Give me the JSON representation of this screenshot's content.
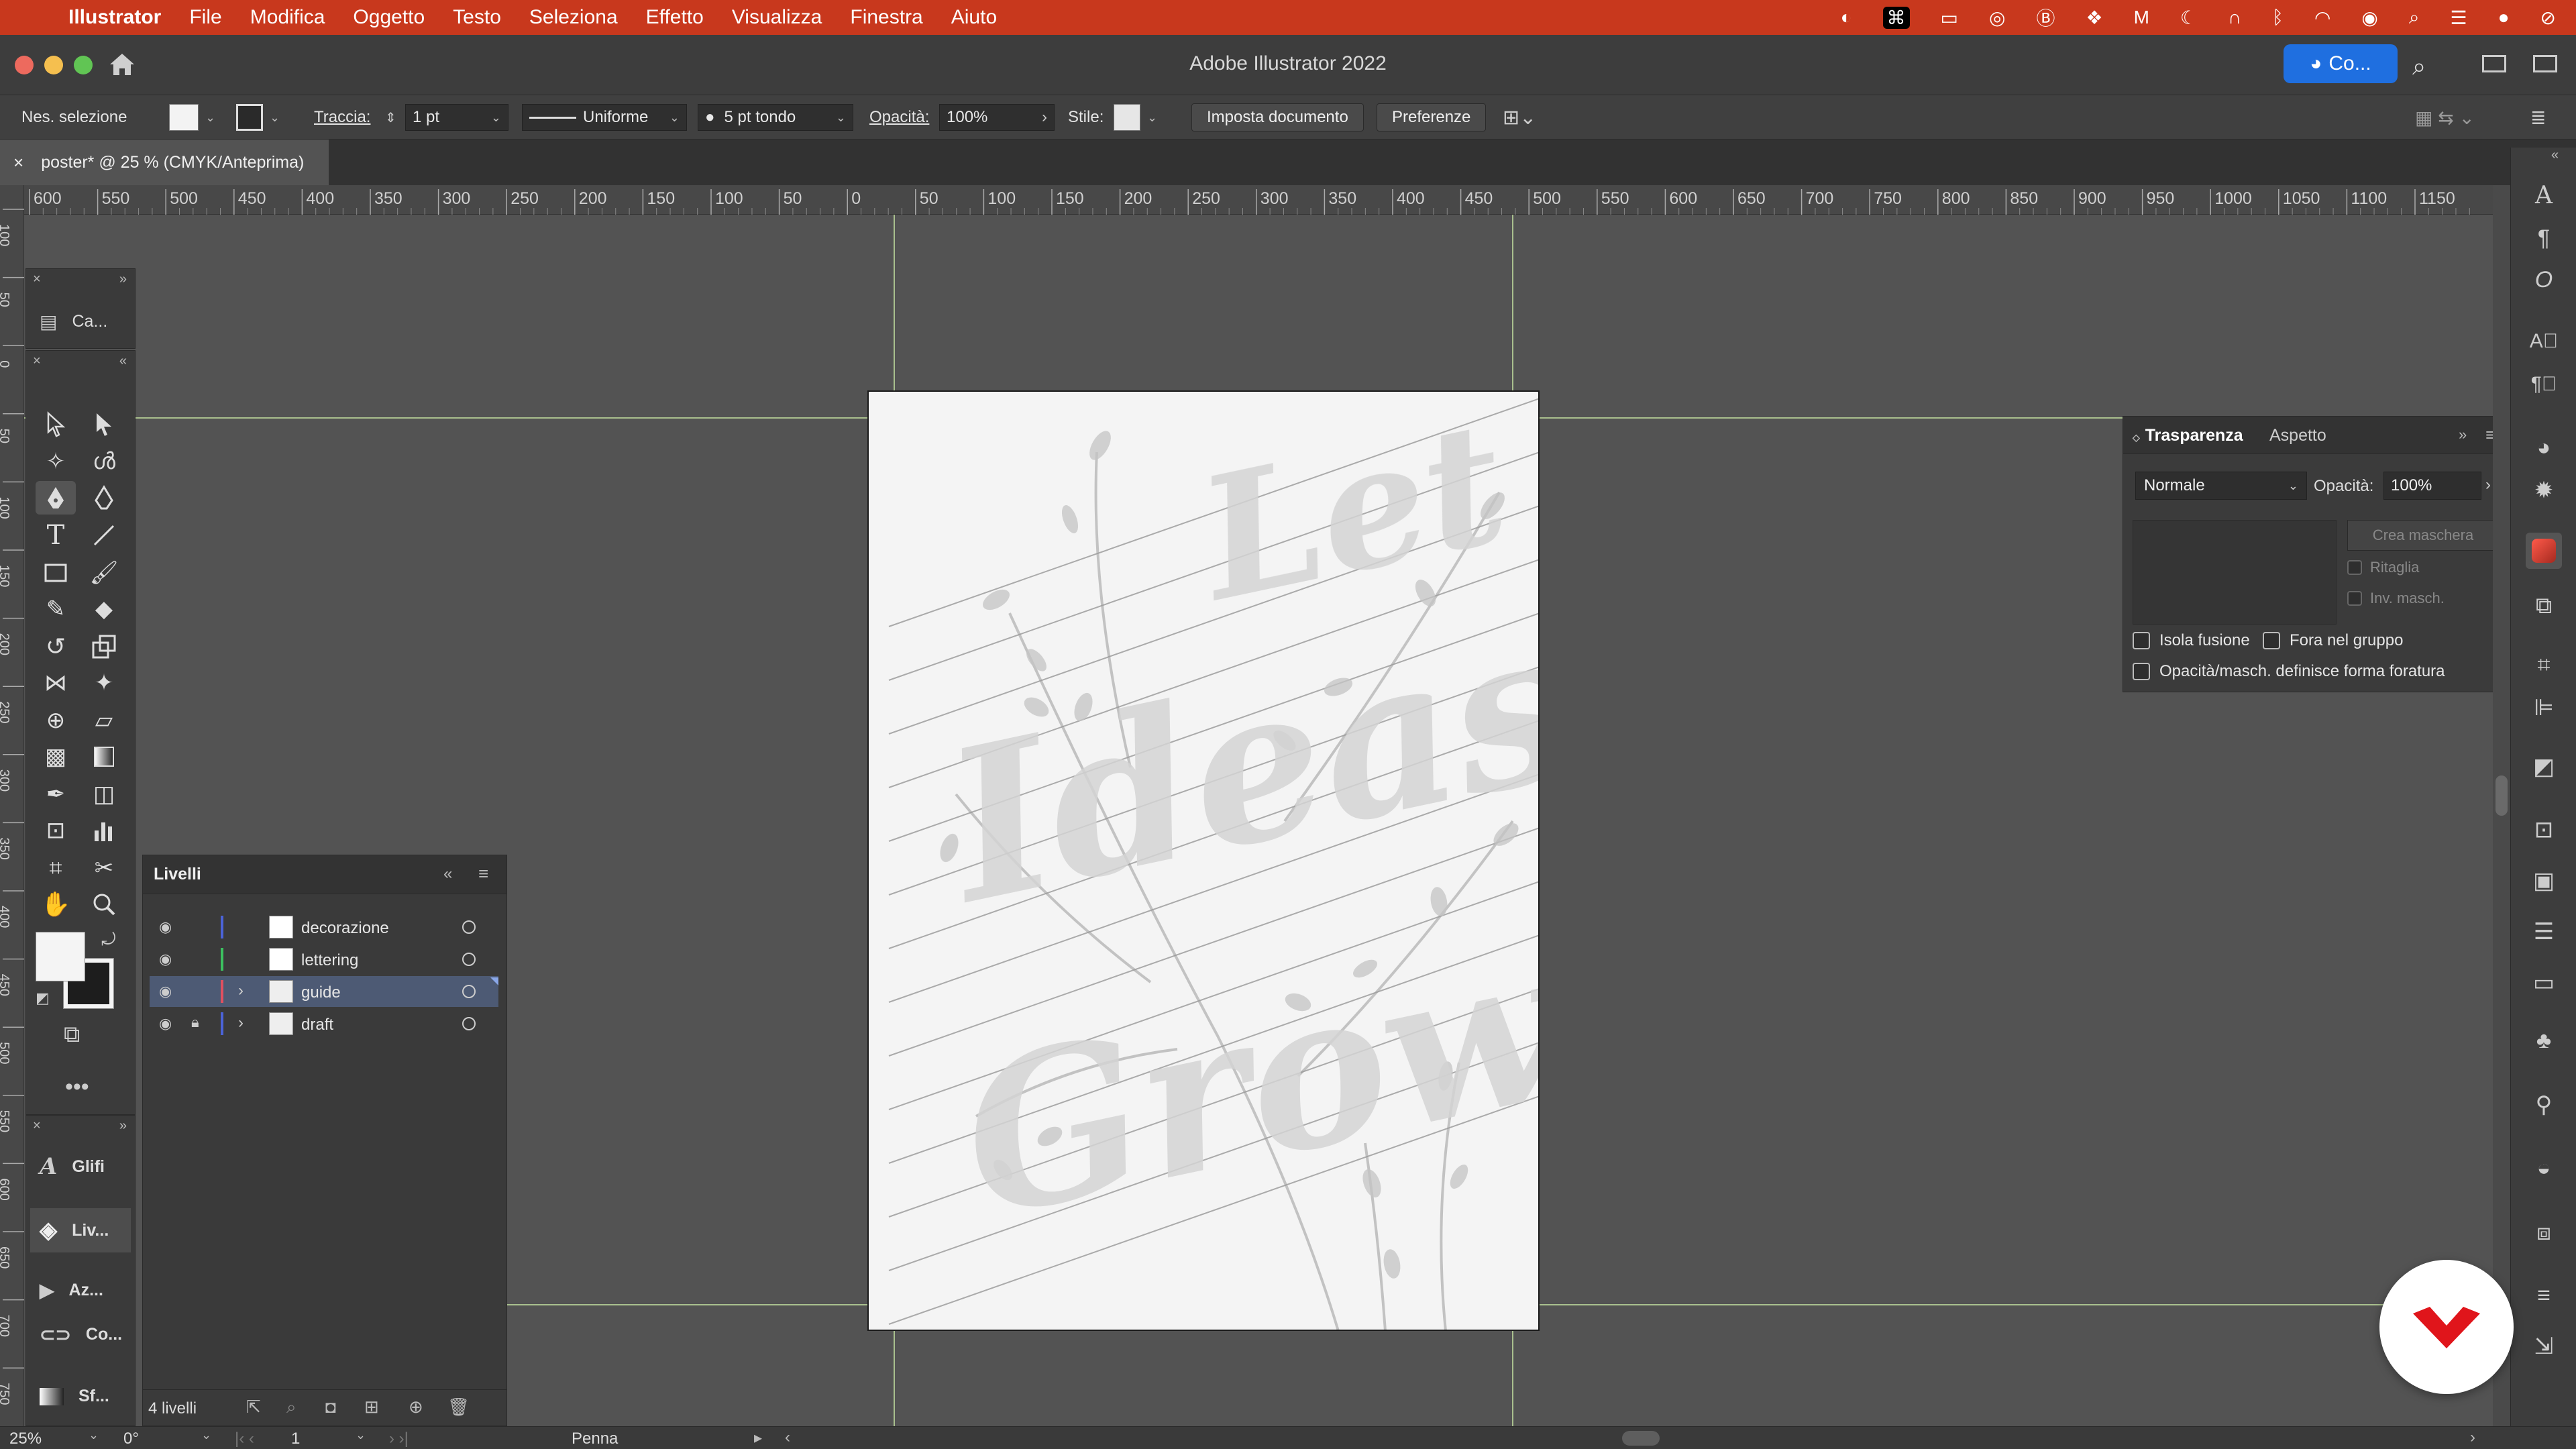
{
  "menubar": {
    "app_name": "Illustrator",
    "items": [
      "File",
      "Modifica",
      "Oggetto",
      "Testo",
      "Seleziona",
      "Effetto",
      "Visualizza",
      "Finestra",
      "Aiuto"
    ]
  },
  "titlebar": {
    "title": "Adobe Illustrator 2022",
    "share_label": "Co..."
  },
  "controlbar": {
    "selection_label": "Nes. selezione",
    "stroke_label": "Traccia:",
    "stroke_weight": "1 pt",
    "profile_label": "Uniforme",
    "brush_label": "5 pt tondo",
    "opacity_label": "Opacità:",
    "opacity_value": "100%",
    "style_label": "Stile:",
    "doc_setup_label": "Imposta documento",
    "prefs_label": "Preferenze"
  },
  "document_tab": {
    "label": "poster* @ 25 % (CMYK/Anteprima)"
  },
  "rulers": {
    "h_ticks": [
      "600",
      "550",
      "500",
      "450",
      "400",
      "350",
      "300",
      "250",
      "200",
      "150",
      "100",
      "50",
      "0",
      "50",
      "100",
      "150",
      "200",
      "250",
      "300",
      "350",
      "400",
      "450",
      "500",
      "550",
      "600",
      "650",
      "700",
      "750",
      "800",
      "850",
      "900",
      "950",
      "1000",
      "1050",
      "1100",
      "1150"
    ],
    "v_ticks": [
      "100",
      "50",
      "0",
      "50",
      "100",
      "150",
      "200",
      "250",
      "300",
      "350",
      "400",
      "450",
      "500",
      "550",
      "600",
      "650",
      "700",
      "750"
    ]
  },
  "collapsed_panels": {
    "top": "Ca...",
    "glyphs": "Glifi",
    "layers": "Liv...",
    "actions": "Az...",
    "links": "Co...",
    "gradient": "Sf..."
  },
  "layers_panel": {
    "title": "Livelli",
    "layers": [
      {
        "name": "decorazione",
        "color": "#4b63d8",
        "locked": false,
        "expandable": false
      },
      {
        "name": "lettering",
        "color": "#3cc060",
        "locked": false,
        "expandable": false
      },
      {
        "name": "guide",
        "color": "#e05060",
        "locked": false,
        "expandable": true
      },
      {
        "name": "draft",
        "color": "#4b63d8",
        "locked": true,
        "expandable": true
      }
    ],
    "selected_index": 2,
    "count_label": "4 livelli"
  },
  "transparency_panel": {
    "tab_active": "Trasparenza",
    "tab_inactive": "Aspetto",
    "blend_mode": "Normale",
    "opacity_label": "Opacità:",
    "opacity_value": "100%",
    "make_mask_label": "Crea maschera",
    "clip_label": "Ritaglia",
    "invert_label": "Inv. masch.",
    "isolate_label": "Isola fusione",
    "knockout_label": "Fora nel gruppo",
    "opacity_mask_label": "Opacità/masch. definisce forma foratura"
  },
  "statusbar": {
    "zoom": "25%",
    "rotation": "0°",
    "artboard_num": "1",
    "tool_name": "Penna"
  },
  "artwork": {
    "text_lines": [
      "Let",
      "Ideas",
      "Grow"
    ]
  },
  "colors": {
    "accent": "#1f6fe0",
    "menubar": "#c8381d",
    "badge": "#e0151b"
  }
}
